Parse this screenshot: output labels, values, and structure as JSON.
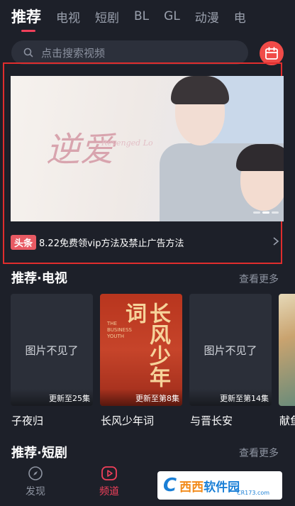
{
  "tabs": [
    {
      "label": "推荐",
      "active": true
    },
    {
      "label": "电视"
    },
    {
      "label": "短剧"
    },
    {
      "label": "BL"
    },
    {
      "label": "GL"
    },
    {
      "label": "动漫"
    },
    {
      "label": "电"
    }
  ],
  "search": {
    "placeholder": "点击搜索视频"
  },
  "banner": {
    "logo_text": "逆爱",
    "logo_sub": "Revenged Love",
    "headline_badge": "头条",
    "headline": "8.22免费领vip方法及禁止广告方法"
  },
  "tv_section": {
    "title": "推荐·电视",
    "more": "查看更多",
    "items": [
      {
        "title": "子夜归",
        "update": "更新至25集",
        "image": "图片不见了"
      },
      {
        "title": "长风少年词",
        "update": "更新至第8集",
        "poster_text": "长风少年词",
        "poster_en": "THE BUSINESS YOUTH"
      },
      {
        "title": "与晋长安",
        "update": "更新至第14集",
        "image": "图片不见了"
      },
      {
        "title": "献鱼"
      }
    ]
  },
  "short_section": {
    "title": "推荐·短剧",
    "more": "查看更多"
  },
  "bottom_nav": [
    {
      "label": "发现",
      "icon": "compass-icon"
    },
    {
      "label": "频道",
      "icon": "play-icon",
      "active": true
    }
  ],
  "watermark": {
    "prefix": "C",
    "brand": "西西",
    "brand2": "软件园",
    "domain": "CR173.com"
  },
  "colors": {
    "accent": "#f0405a",
    "background": "#1d2029",
    "calendar": "#f04b48"
  }
}
